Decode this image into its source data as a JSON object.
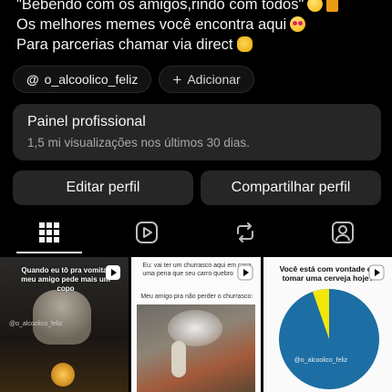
{
  "profile": {
    "bio_lines": [
      "\"Bebendo com os amigos,rindo com todos\"",
      "Os melhores memes você encontra aqui",
      "Para parcerias chamar via direct"
    ]
  },
  "links": {
    "threads_handle": "o_alcoolico_feliz",
    "add_label": "Adicionar"
  },
  "professional_panel": {
    "title": "Painel profissional",
    "subtitle": "1,5 mi visualizações nos últimos 30 dias."
  },
  "actions": {
    "edit_label": "Editar perfil",
    "share_label": "Compartilhar perfil"
  },
  "tabs": [
    {
      "icon": "grid-icon",
      "active": true
    },
    {
      "icon": "reels-icon",
      "active": false
    },
    {
      "icon": "reposts-icon",
      "active": false
    },
    {
      "icon": "tagged-icon",
      "active": false
    }
  ],
  "posts": [
    {
      "caption": "Quando eu tô pra vomitar meu amigo pede mais um copo",
      "watermark": "@o_alcoolico_feliz"
    },
    {
      "caption_top": "Eu: vai ter um churrasco aqui em casa uma pena que seu carro quebro",
      "caption_mid": "Meu amigo pra não perder o churrasco:"
    },
    {
      "caption": "Você está com vontade de tomar uma cerveja hoje?",
      "watermark": "@o_alcoolico_feliz",
      "pie_colors": [
        "#1c6ea4",
        "#f5e60a"
      ]
    }
  ]
}
